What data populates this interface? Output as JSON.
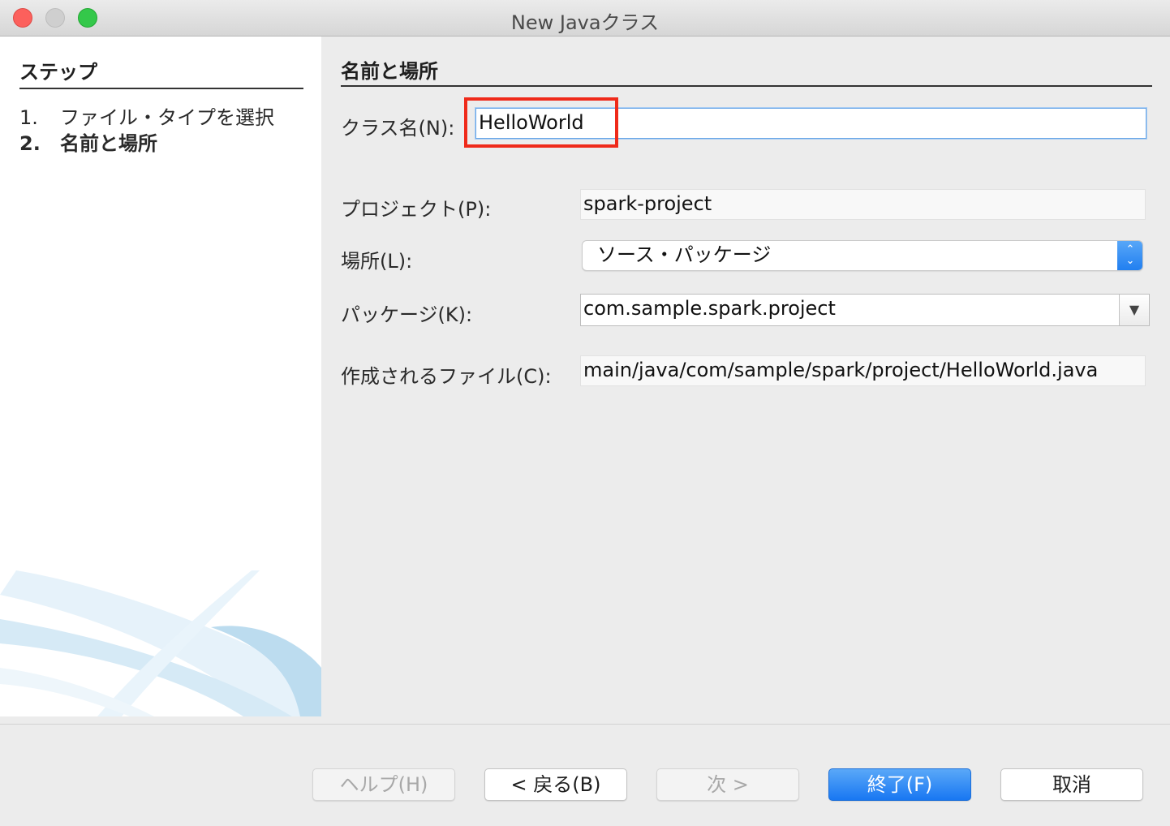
{
  "window": {
    "title": "New Javaクラス"
  },
  "sidebar": {
    "header": "ステップ",
    "steps": [
      {
        "num": "1.",
        "label": "ファイル・タイプを選択"
      },
      {
        "num": "2.",
        "label": "名前と場所"
      }
    ]
  },
  "main": {
    "header": "名前と場所",
    "class_name": {
      "label": "クラス名(N):",
      "value": "HelloWorld"
    },
    "project": {
      "label": "プロジェクト(P):",
      "value": "spark-project"
    },
    "location": {
      "label": "場所(L):",
      "value": "ソース・パッケージ"
    },
    "package": {
      "label": "パッケージ(K):",
      "value": "com.sample.spark.project"
    },
    "created_file": {
      "label": "作成されるファイル(C):",
      "value": "main/java/com/sample/spark/project/HelloWorld.java"
    }
  },
  "buttons": {
    "help": "ヘルプ(H)",
    "back": "< 戻る(B)",
    "next": "次 >",
    "finish": "終了(F)",
    "cancel": "取消"
  },
  "colors": {
    "accent": "#1877f2",
    "highlight": "#ef2a1a"
  }
}
